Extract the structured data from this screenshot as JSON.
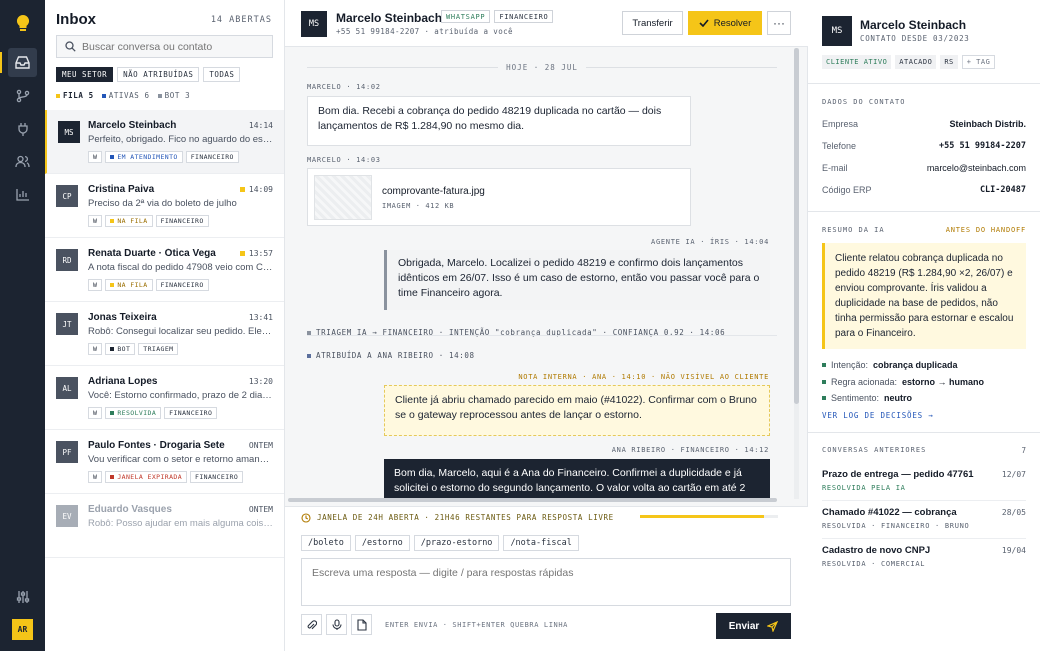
{
  "rail": {
    "items": [
      {
        "name": "inbox",
        "icon": "inbox-icon",
        "active": true
      },
      {
        "name": "flows",
        "icon": "branch-icon",
        "active": false
      },
      {
        "name": "integrations",
        "icon": "plug-icon",
        "active": false
      },
      {
        "name": "contacts",
        "icon": "users-icon",
        "active": false
      },
      {
        "name": "reports",
        "icon": "bar-chart-icon",
        "active": false
      }
    ],
    "settings_icon": "sliders-icon",
    "user_initials": "AR",
    "accent": "#f5c518"
  },
  "inbox": {
    "title": "Inbox",
    "count": "14 ABERTAS",
    "search_placeholder": "Buscar conversa ou contato",
    "filters": [
      "MEU SETOR",
      "NÃO ATRIBUÍDAS",
      "TODAS"
    ],
    "stats": [
      {
        "label": "FILA 5",
        "color": "#f5c518"
      },
      {
        "label": "ATIVAS 6",
        "color": "#2356b8"
      },
      {
        "label": "BOT 3",
        "color": "#8a929e"
      }
    ],
    "conversations": [
      {
        "initials": "MS",
        "name": "Marcelo Steinbach",
        "time": "14:14",
        "preview": "Perfeito, obrigado. Fico no aguardo do estorno.",
        "channel": "W",
        "status": "EM ATENDIMENTO",
        "status_color": "#2356b8",
        "sector": "FINANCEIRO",
        "av_color": "#1c2431",
        "urgent": false
      },
      {
        "initials": "CP",
        "name": "Cristina Paiva",
        "time": "14:09",
        "preview": "Preciso da 2ª via do boleto de julho",
        "channel": "W",
        "status": "NA FILA",
        "status_color": "#f5c518",
        "sector": "FINANCEIRO",
        "av_color": "#4a5260",
        "urgent": true
      },
      {
        "initials": "RD",
        "name": "Renata Duarte · Ótica Vega",
        "time": "13:57",
        "preview": "A nota fiscal do pedido 47908 veio com CNPJ errado",
        "channel": "W",
        "status": "NA FILA",
        "status_color": "#f5c518",
        "sector": "FINANCEIRO",
        "av_color": "#4a5260",
        "urgent": true
      },
      {
        "initials": "JT",
        "name": "Jonas Teixeira",
        "time": "13:41",
        "preview": "Robô: Consegui localizar seu pedido. Ele saiu para entrega",
        "channel": "W",
        "status": "BOT",
        "status_color": "#1c2431",
        "sector": "TRIAGEM",
        "av_color": "#4a5260",
        "urgent": false
      },
      {
        "initials": "AL",
        "name": "Adriana Lopes",
        "time": "13:20",
        "preview": "Você: Estorno confirmado, prazo de 2 dias úteis.",
        "channel": "W",
        "status": "RESOLVIDA",
        "status_color": "#2e7d5b",
        "sector": "FINANCEIRO",
        "av_color": "#4a5260",
        "urgent": false
      },
      {
        "initials": "PF",
        "name": "Paulo Fontes · Drogaria Sete",
        "time": "ONTEM",
        "preview": "Vou verificar com o setor e retorno amanhã cedo.",
        "channel": "W",
        "status": "JANELA EXPIRADA",
        "status_color": "#c0392b",
        "sector": "FINANCEIRO",
        "av_color": "#4a5260",
        "urgent": false
      },
      {
        "initials": "EV",
        "name": "Eduardo Vasques",
        "time": "ONTEM",
        "preview": "Robô: Posso ajudar em mais alguma coisa?",
        "av_color": "#a7adb6",
        "dim": true
      }
    ]
  },
  "chat": {
    "initials": "MS",
    "name": "Marcelo Steinbach",
    "badges": [
      "WHATSAPP",
      "FINANCEIRO"
    ],
    "subtitle": "+55 51 99184-2207 · atribuída a você",
    "transfer": "Transferir",
    "resolve": "Resolver",
    "more": "···",
    "day": "HOJE · 28 JUL",
    "m1_meta": "MARCELO · 14:02",
    "m1_text": "Bom dia. Recebi a cobrança do pedido 48219 duplicada no cartão — dois lançamentos de R$ 1.284,90 no mesmo dia.",
    "m2_meta": "MARCELO · 14:03",
    "file_name": "comprovante-fatura.jpg",
    "file_meta": "IMAGEM · 412 KB",
    "m3_meta": "AGENTE IA · ÍRIS · 14:04",
    "m3_text": "Obrigada, Marcelo. Localizei o pedido 48219 e confirmo dois lançamentos idênticos em 26/07. Isso é um caso de estorno, então vou passar você para o time Financeiro agora.",
    "sys1": "TRIAGEM IA → FINANCEIRO · INTENÇÃO \"cobrança duplicada\" · CONFIANÇA 0,92 · 14:06",
    "sys2": "ATRIBUÍDA A ANA RIBEIRO · 14:08",
    "note_meta": "NOTA INTERNA · ANA · 14:10 · NÃO VISÍVEL AO CLIENTE",
    "note_text": "Cliente já abriu chamado parecido em maio (#41022). Confirmar com o Bruno se o gateway reprocessou antes de lançar o estorno.",
    "m4_meta": "ANA RIBEIRO · FINANCEIRO · 14:12",
    "m4_text": "Bom dia, Marcelo, aqui é a Ana do Financeiro. Confirmei a duplicidade e já solicitei o estorno do segundo lançamento. O valor volta ao cartão em até 2",
    "window_text": "JANELA DE 24H ABERTA · 21H46 RESTANTES PARA RESPOSTA LIVRE",
    "window_fraction": 0.9,
    "quick": [
      "/boleto",
      "/estorno",
      "/prazo-estorno",
      "/nota-fiscal"
    ],
    "composer_placeholder": "Escreva uma resposta — digite / para respostas rápidas",
    "hint": "ENTER ENVIA · SHIFT+ENTER QUEBRA LINHA",
    "send": "Enviar"
  },
  "details": {
    "initials": "MS",
    "name": "Marcelo Steinbach",
    "since": "CONTATO DESDE 03/2023",
    "tags": [
      "CLIENTE ATIVO",
      "ATACADO",
      "RS",
      "+ TAG"
    ],
    "contact_title": "DADOS DO CONTATO",
    "fields": [
      {
        "k": "Empresa",
        "v": "Steinbach Distrib."
      },
      {
        "k": "Telefone",
        "v": "+55 51 99184-2207"
      },
      {
        "k": "E-mail",
        "v": "marcelo@steinbach.com"
      },
      {
        "k": "Código ERP",
        "v": "CLI-20487"
      }
    ],
    "summary_title": "RESUMO DA IA",
    "summary_badge": "ANTES DO HANDOFF",
    "summary_text": "Cliente relatou cobrança duplicada no pedido 48219 (R$ 1.284,90 ×2, 26/07) e enviou comprovante. Íris validou a duplicidade na base de pedidos, não tinha permissão para estornar e escalou para o Financeiro.",
    "facts": [
      {
        "k": "Intenção:",
        "v": "cobrança duplicada"
      },
      {
        "k": "Regra acionada:",
        "v": "estorno → humano"
      },
      {
        "k": "Sentimento:",
        "v": "neutro"
      }
    ],
    "log_link": "VER LOG DE DECISÕES →",
    "prev_title": "CONVERSAS ANTERIORES",
    "prev_count": "7",
    "previous": [
      {
        "title": "Prazo de entrega — pedido 47761",
        "date": "12/07",
        "status": "RESOLVIDA PELA IA",
        "color": "#2e7d5b"
      },
      {
        "title": "Chamado #41022 — cobrança",
        "date": "28/05",
        "status": "RESOLVIDA · FINANCEIRO · BRUNO",
        "color": "#5a6270"
      },
      {
        "title": "Cadastro de novo CNPJ",
        "date": "19/04",
        "status": "RESOLVIDA · COMERCIAL",
        "color": "#5a6270"
      }
    ]
  }
}
